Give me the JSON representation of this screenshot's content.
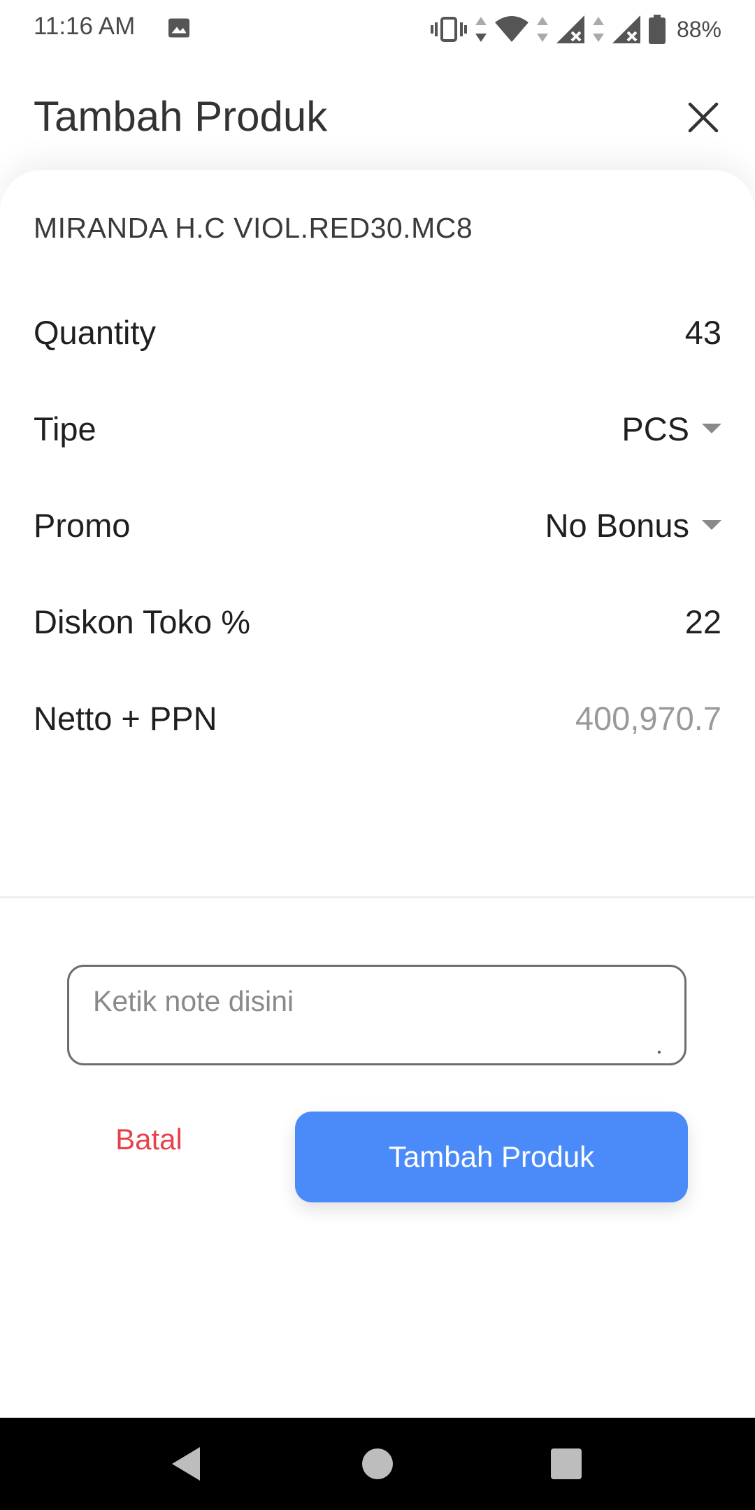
{
  "status_bar": {
    "time": "11:16 AM",
    "battery_percent": "88%",
    "icons": [
      "image-icon",
      "vibrate-icon",
      "wifi-icon",
      "signal-icon",
      "signal-icon",
      "battery-icon"
    ]
  },
  "header": {
    "title": "Tambah Produk",
    "close_icon": "close-icon"
  },
  "product": {
    "name": "MIRANDA H.C VIOL.RED30.MC8"
  },
  "form": {
    "quantity": {
      "label": "Quantity",
      "value": "43"
    },
    "tipe": {
      "label": "Tipe",
      "value": "PCS"
    },
    "promo": {
      "label": "Promo",
      "value": "No Bonus"
    },
    "diskon": {
      "label": "Diskon Toko %",
      "value": "22"
    },
    "netto": {
      "label": "Netto + PPN",
      "value": "400,970.7"
    }
  },
  "note": {
    "placeholder": "Ketik note disini",
    "value": ""
  },
  "actions": {
    "cancel_label": "Batal",
    "submit_label": "Tambah Produk"
  },
  "colors": {
    "accent": "#4b8bf9",
    "cancel": "#e8414a",
    "muted_value": "#9a9a9a"
  },
  "nav_bar": {
    "icons": [
      "back-icon",
      "home-icon",
      "recents-icon"
    ]
  }
}
